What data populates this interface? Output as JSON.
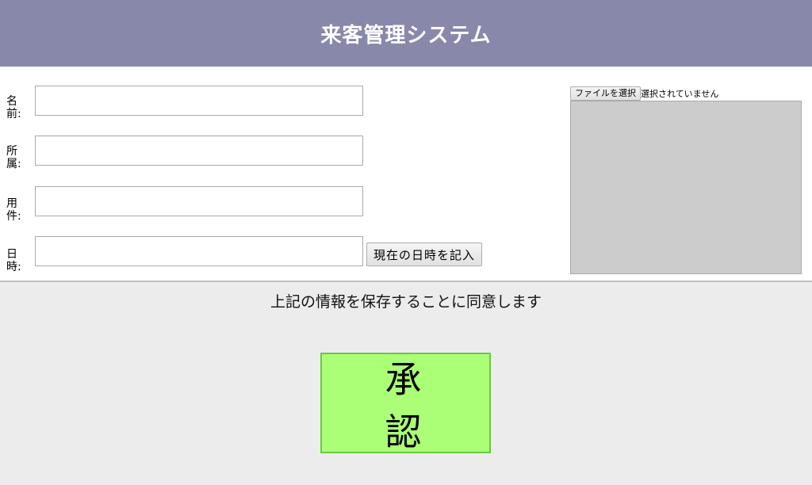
{
  "header": {
    "title": "来客管理システム"
  },
  "form": {
    "fields": [
      {
        "label": "名前:",
        "value": ""
      },
      {
        "label": "所属:",
        "value": ""
      },
      {
        "label": "用件:",
        "value": ""
      },
      {
        "label": "日時:",
        "value": ""
      }
    ],
    "now_button_label": "現在の日時を記入"
  },
  "photo": {
    "file_button_label": "ファイルを選択",
    "file_status": "選択されていません",
    "preview_color": "#cccccc"
  },
  "consent": {
    "text": "上記の情報を保存することに同意します",
    "approve_label": "承認"
  },
  "colors": {
    "header_bg": "#8888aa",
    "approve_bg": "#aaff77",
    "bottom_bg": "#ececec"
  }
}
